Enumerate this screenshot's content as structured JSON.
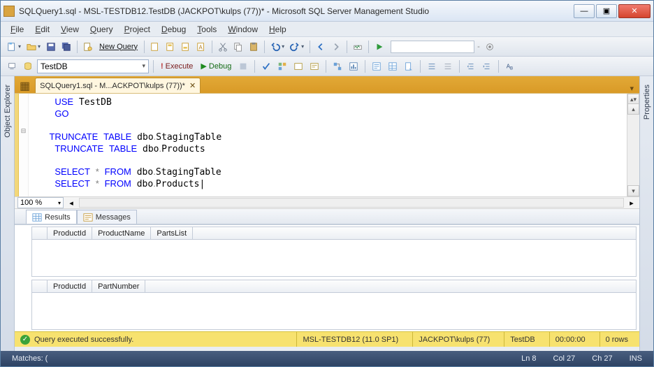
{
  "window": {
    "title": "SQLQuery1.sql - MSL-TESTDB12.TestDB (JACKPOT\\kulps (77))* - Microsoft SQL Server Management Studio"
  },
  "menu": {
    "file": "File",
    "edit": "Edit",
    "view": "View",
    "query": "Query",
    "project": "Project",
    "debug": "Debug",
    "tools": "Tools",
    "window": "Window",
    "help": "Help"
  },
  "toolbar1": {
    "new_query": "New Query"
  },
  "toolbar2": {
    "database": "TestDB",
    "execute": "Execute",
    "debug": "Debug"
  },
  "side": {
    "left": "Object Explorer",
    "right": "Properties"
  },
  "doc_tab": {
    "label": "SQLQuery1.sql - M...ACKPOT\\kulps (77))*"
  },
  "editor": {
    "code_html": "    <span class='kw'>USE</span> TestDB\n    <span class='kw'>GO</span>\n\n   <span class='kw'>TRUNCATE</span> <span class='kw'>TABLE</span> dbo<span class='op'>.</span>StagingTable\n    <span class='kw'>TRUNCATE</span> <span class='kw'>TABLE</span> dbo<span class='op'>.</span>Products\n\n    <span class='kw'>SELECT</span> <span class='op'>*</span> <span class='kw'>FROM</span> dbo<span class='op'>.</span>StagingTable\n    <span class='kw'>SELECT</span> <span class='op'>*</span> <span class='kw'>FROM</span> dbo<span class='op'>.</span>Products|",
    "zoom": "100 %",
    "fold_marker": "⊟"
  },
  "results": {
    "tab_results": "Results",
    "tab_messages": "Messages",
    "grid1_cols": [
      "ProductId",
      "ProductName",
      "PartsList"
    ],
    "grid2_cols": [
      "ProductId",
      "PartNumber"
    ]
  },
  "exec_status": {
    "message": "Query executed successfully.",
    "server": "MSL-TESTDB12 (11.0 SP1)",
    "user": "JACKPOT\\kulps (77)",
    "db": "TestDB",
    "elapsed": "00:00:00",
    "rows": "0 rows"
  },
  "statusbar": {
    "matches": "Matches: (",
    "ln": "Ln 8",
    "col": "Col 27",
    "ch": "Ch 27",
    "ins": "INS"
  }
}
